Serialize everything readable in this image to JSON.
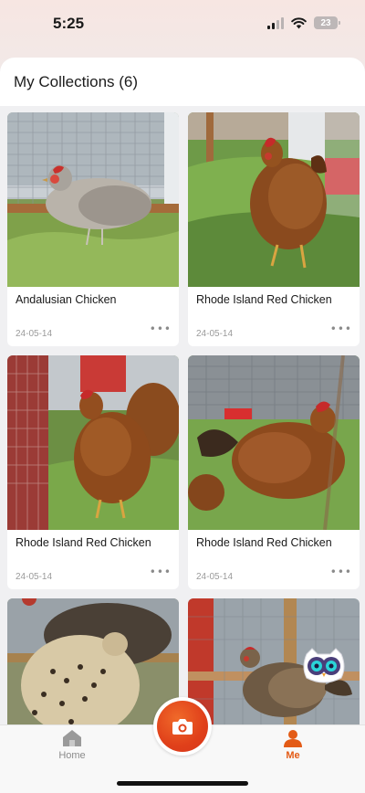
{
  "status_bar": {
    "time": "5:25",
    "battery": "23"
  },
  "header": {
    "title": "My Collections (6)"
  },
  "collection": [
    {
      "name": "Andalusian Chicken",
      "date": "24-05-14",
      "more": "•••"
    },
    {
      "name": "Rhode Island Red Chicken",
      "date": "24-05-14",
      "more": "•••"
    },
    {
      "name": "Rhode Island Red Chicken",
      "date": "24-05-14",
      "more": "•••"
    },
    {
      "name": "Rhode Island Red Chicken",
      "date": "24-05-14",
      "more": "•••"
    },
    {
      "name": "",
      "date": "",
      "more": ""
    },
    {
      "name": "",
      "date": "",
      "more": ""
    }
  ],
  "tabbar": {
    "home_label": "Home",
    "me_label": "Me",
    "camera_icon": "camera-icon",
    "accent_color": "#e35b16"
  }
}
